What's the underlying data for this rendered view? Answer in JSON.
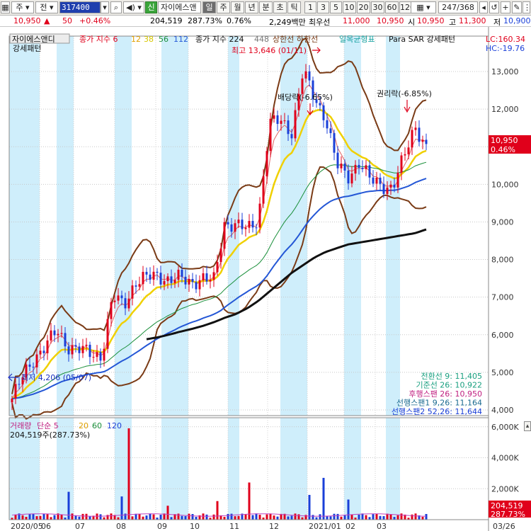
{
  "toolbar": {
    "market": "주",
    "filter": "전",
    "code": "317400",
    "new_badge": "신",
    "stock_name": "자이에스앤",
    "periods": [
      "일",
      "주",
      "월",
      "년",
      "분",
      "초",
      "틱"
    ],
    "active_period": "일",
    "intervals": [
      "1",
      "3",
      "5",
      "10",
      "20",
      "30",
      "60",
      "120"
    ],
    "page_count": "247/368"
  },
  "quote": {
    "price": "10,950",
    "arrow": "▲",
    "change": "50",
    "change_pct": "+0.46%",
    "volume": "204,519",
    "volume_ratio": "287.73%",
    "turnover": "0.76%",
    "amount": "2,249백만",
    "ask_label": "최우선",
    "ask": "11,000",
    "bid": "10,950",
    "open_label": "시",
    "open": "10,950",
    "high_label": "고",
    "high": "11,300",
    "low_label": "저",
    "low": "10,900"
  },
  "colors": {
    "up": "#e0001b",
    "down": "#1a3fd8",
    "shade": "#cfeefb",
    "ma5": "#e06464",
    "ma12": "#f0d000",
    "ma38": "#1a8f3a",
    "ma112": "#2457d6",
    "ma224": "#111111",
    "band": "#7a3b16"
  },
  "legend": {
    "title": "자이에스앤디",
    "label_ma": "종가 지수 6",
    "p12": "12",
    "p38": "38",
    "p56": "56",
    "p112": "112",
    "label_ma2": "종가 지수 224",
    "p448": "448",
    "limit_lines": "상한선 하한선",
    "ichimoku": "일목균형표",
    "psar": "Para SAR 강세패턴",
    "psar2": "강세패턴"
  },
  "right_info": {
    "lc": "LC:160.34",
    "hc": "HC:-19.76"
  },
  "annotations": {
    "high": "최고 13,646 (01/11)",
    "low": "최저 4,206 (05/07)",
    "dividend": "배당락(-6.65%)",
    "rights": "권리락(-6.85%)"
  },
  "ichimoku_info": [
    "전환선 9: 11,405",
    "기준선 26: 10,922",
    "후행스팬 26: 10,950",
    "선행스팬1 9,26: 11,164",
    "선행스팬2 52,26: 11,644"
  ],
  "price_tag": {
    "value": "10,950",
    "pct": "0.46%"
  },
  "volume_legend": {
    "label": "거래량",
    "label2": "단순 5",
    "p20": "20",
    "p60": "60",
    "p120": "120",
    "value": "204,519주(287.73%)"
  },
  "volume_tag": {
    "value": "204,519",
    "pct": "287.73%"
  },
  "chart_data": [
    {
      "type": "line",
      "title": "",
      "x": [
        "2020/05",
        "06",
        "07",
        "08",
        "09",
        "10",
        "11",
        "12",
        "2021/01",
        "02",
        "03",
        "03/26"
      ],
      "ylim": [
        3500,
        13800
      ],
      "yticks": [
        4000,
        5000,
        6000,
        7000,
        8000,
        9000,
        10000,
        11000,
        12000,
        13000
      ],
      "ytick_labels": [
        "4,000",
        "5,000",
        "6,000",
        "7,000",
        "8,000",
        "9,000",
        "10,000",
        "11,000",
        "12,000",
        "13,000"
      ],
      "series": [
        {
          "name": "종가",
          "values": [
            4300,
            4900,
            5400,
            5700,
            6100,
            5700,
            5600,
            5500,
            5450,
            7000,
            6800,
            7400,
            7500,
            7600,
            7450,
            7500,
            7400,
            7500,
            7400,
            9000,
            8900,
            8800,
            9100,
            11600,
            11700,
            11400,
            13000,
            12300,
            11800,
            10500,
            10200,
            10600,
            10100,
            10000,
            9900,
            10700,
            11600,
            10950
          ]
        },
        {
          "name": "224",
          "values": [
            null,
            null,
            null,
            null,
            null,
            null,
            null,
            null,
            null,
            null,
            null,
            null,
            5880,
            5930,
            6000,
            6080,
            6150,
            6230,
            6330,
            6450,
            6550,
            6700,
            6900,
            7150,
            7400,
            7650,
            7850,
            8050,
            8200,
            8300,
            8400,
            8450,
            8500,
            8550,
            8600,
            8650,
            8700,
            8800
          ]
        }
      ],
      "grid": true
    },
    {
      "type": "bar",
      "title": "",
      "yticks": [
        2000,
        4000,
        6000
      ],
      "ytick_labels": [
        "2,000K",
        "4,000K",
        "6,000K"
      ],
      "ylim": [
        0,
        6400
      ]
    }
  ]
}
